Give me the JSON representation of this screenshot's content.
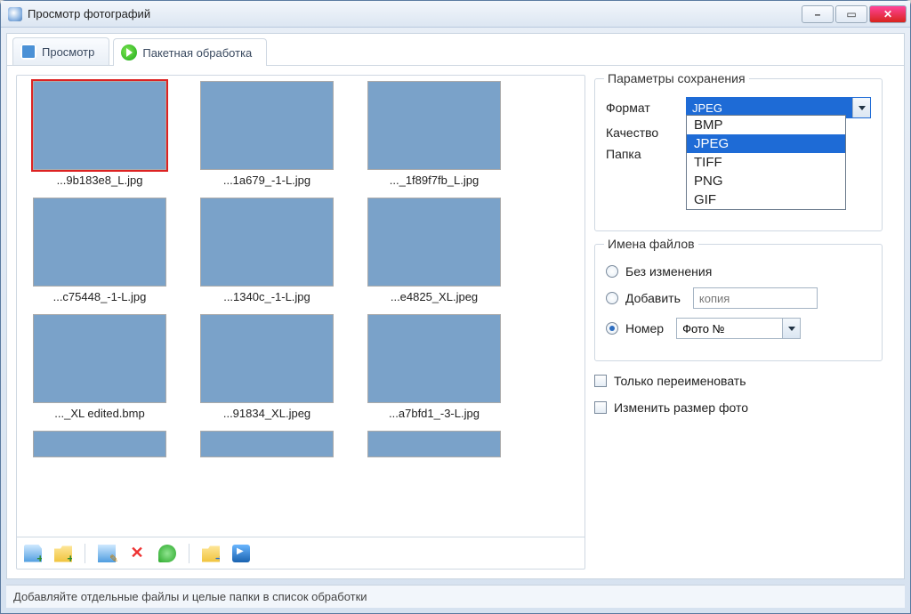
{
  "title": "Просмотр фотографий",
  "tabs": {
    "view": "Просмотр",
    "batch": "Пакетная обработка"
  },
  "thumbs": [
    {
      "name": "...9b183e8_L.jpg",
      "selected": true,
      "v": 0
    },
    {
      "name": "...1a679_-1-L.jpg",
      "selected": false,
      "v": 1
    },
    {
      "name": "..._1f89f7fb_L.jpg",
      "selected": false,
      "v": 2
    },
    {
      "name": "...c75448_-1-L.jpg",
      "selected": false,
      "v": 3
    },
    {
      "name": "...1340c_-1-L.jpg",
      "selected": false,
      "v": 4
    },
    {
      "name": "...e4825_XL.jpeg",
      "selected": false,
      "v": 5
    },
    {
      "name": "..._XL edited.bmp",
      "selected": false,
      "v": 6
    },
    {
      "name": "...91834_XL.jpeg",
      "selected": false,
      "v": 7
    },
    {
      "name": "...a7bfd1_-3-L.jpg",
      "selected": false,
      "v": 8
    }
  ],
  "thumbs_partial": [
    {
      "v": 9
    },
    {
      "v": 10
    },
    {
      "v": 11
    }
  ],
  "save": {
    "group_title": "Параметры сохранения",
    "format_label": "Формат",
    "format_value": "JPEG",
    "format_options": [
      "BMP",
      "JPEG",
      "TIFF",
      "PNG",
      "GIF"
    ],
    "format_selected": "JPEG",
    "quality_label": "Качество",
    "folder_label": "Папка"
  },
  "names": {
    "group_title": "Имена файлов",
    "keep": "Без изменения",
    "append": "Добавить",
    "append_value": "копия",
    "number": "Номер",
    "number_value": "Фото №",
    "selected": "number"
  },
  "checks": {
    "rename_only": "Только переименовать",
    "resize": "Изменить размер фото"
  },
  "status": "Добавляйте отдельные файлы и целые папки в список обработки"
}
